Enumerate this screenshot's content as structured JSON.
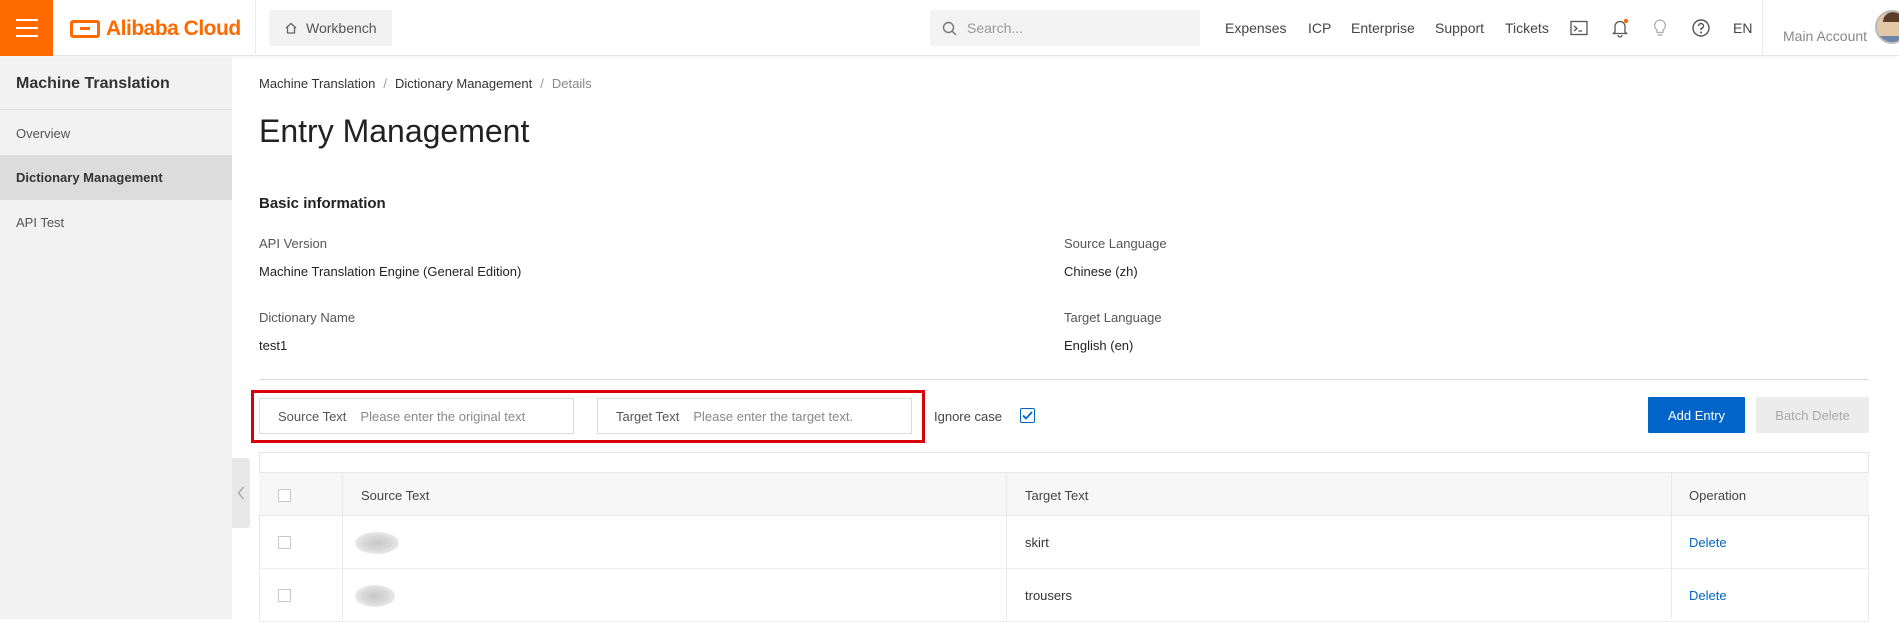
{
  "topbar": {
    "brand": "Alibaba Cloud",
    "workbench_label": "Workbench",
    "search_placeholder": "Search...",
    "nav_items": [
      "Expenses",
      "ICP",
      "Enterprise",
      "Support",
      "Tickets"
    ],
    "language": "EN",
    "account_label": "Main Account",
    "accent_color": "#ff6a00"
  },
  "sidebar": {
    "title": "Machine Translation",
    "items": [
      {
        "label": "Overview",
        "active": false
      },
      {
        "label": "Dictionary Management",
        "active": true
      },
      {
        "label": "API Test",
        "active": false
      }
    ]
  },
  "breadcrumb": [
    "Machine Translation",
    "Dictionary Management",
    "Details"
  ],
  "page_title": "Entry Management",
  "basic_info": {
    "title": "Basic information",
    "api_version_label": "API Version",
    "api_version_value": "Machine Translation Engine (General Edition)",
    "source_language_label": "Source Language",
    "source_language_value": "Chinese (zh)",
    "dictionary_name_label": "Dictionary Name",
    "dictionary_name_value": "test1",
    "target_language_label": "Target Language",
    "target_language_value": "English (en)"
  },
  "filters": {
    "source_label": "Source Text",
    "source_placeholder": "Please enter the original text",
    "target_label": "Target Text",
    "target_placeholder": "Please enter the target text.",
    "ignore_case_label": "Ignore case",
    "ignore_case_checked": true
  },
  "actions": {
    "add_entry": "Add Entry",
    "batch_delete": "Batch Delete"
  },
  "table": {
    "columns": [
      "Source Text",
      "Target Text",
      "Operation"
    ],
    "rows": [
      {
        "target": "skirt",
        "operation": "Delete"
      },
      {
        "target": "trousers",
        "operation": "Delete"
      }
    ]
  },
  "colors": {
    "primary": "#0064c8",
    "highlight": "#d9000c"
  }
}
